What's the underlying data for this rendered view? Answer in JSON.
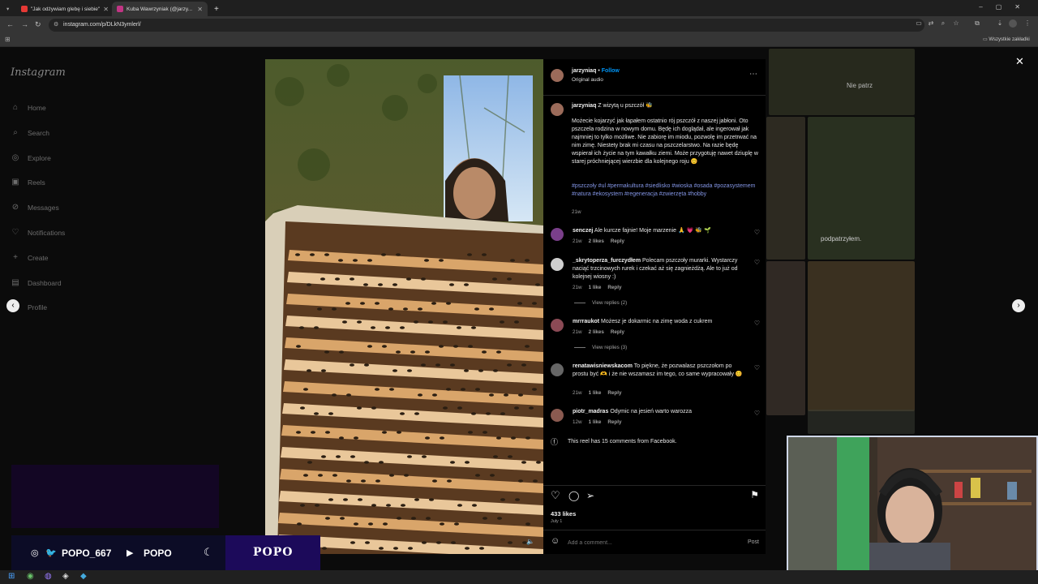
{
  "browser": {
    "tabs": [
      {
        "title": "\"Jak odżywiam glebę i siebie\"",
        "favicon_color": "#e53935"
      },
      {
        "title": "Kuba Wawrzyniak (@jarzy...",
        "favicon_color": "#c13584"
      }
    ],
    "url": "instagram.com/p/DLkN3ymlerl/",
    "bookmarks_label": "Wszystkie zakładki"
  },
  "sidebar": {
    "logo": "Instagram",
    "items": [
      {
        "label": "Home",
        "icon": "home-icon",
        "glyph": "⌂"
      },
      {
        "label": "Search",
        "icon": "search-icon",
        "glyph": "⌕"
      },
      {
        "label": "Explore",
        "icon": "compass-icon",
        "glyph": "◎"
      },
      {
        "label": "Reels",
        "icon": "reels-icon",
        "glyph": "▣"
      },
      {
        "label": "Messages",
        "icon": "messenger-icon",
        "glyph": "⊘"
      },
      {
        "label": "Notifications",
        "icon": "heart-icon",
        "glyph": "♡"
      },
      {
        "label": "Create",
        "icon": "plus-icon",
        "glyph": "+"
      },
      {
        "label": "Dashboard",
        "icon": "dashboard-icon",
        "glyph": "▤"
      },
      {
        "label": "Profile",
        "icon": "profile-icon",
        "glyph": "●"
      }
    ]
  },
  "post": {
    "author": "jarzyniaq",
    "follow_label": "Follow",
    "separator": "•",
    "audio": "Original audio",
    "caption_intro": "Z wizytą u pszczół 🐝",
    "caption": "Możecie kojarzyć jak łapałem ostatnio rój pszczół z naszej jabłoni. Oto pszczela rodzina w nowym domu. Będę ich doglądał, ale ingerował jak najmniej to tylko możliwe. Nie zabiorę im miodu, pozwolę im przetrwać na nim zimę. Niestety brak mi czasu na pszczelarstwo. Na razie będę wspierał ich życie na tym kawałku ziemi. Może przygotuję nawet dziuplę w starej próchniejącej wierzbie dla kolejnego roju 😊",
    "hashtags": "#pszczoły #ul #permakultura #siedlisko #wioska #osada #pozasystemem #natura #ekosystem #regeneracja #zwierzęta #hobby",
    "caption_time": "21w",
    "likes": "433 likes",
    "date": "July 1",
    "comment_placeholder": "Add a comment...",
    "post_button": "Post",
    "facebook_note": "This reel has 15 comments from Facebook.",
    "bg_watermarks": [
      "Nie patrz",
      "podpatrzyłem."
    ]
  },
  "comments": [
    {
      "user": "senczej",
      "text": "Ale kurcze fajnie! Moje marzenie 🙏 💗 🐝 🌱",
      "time": "21w",
      "likes": "2 likes",
      "reply": "Reply",
      "avatar_color": "#7a3f8a"
    },
    {
      "user": "_skrytoperza_furczydłem",
      "text": "Polecam pszczoły murarki. Wystarczy naciąć trzcinowych rurek i czekać aż się zagnieżdżą. Ale to już od kolejnej wiosny :)",
      "time": "21w",
      "likes": "1 like",
      "reply": "Reply",
      "view_replies": "View replies (2)",
      "avatar_color": "#cfcfcf"
    },
    {
      "user": "mrrraukot",
      "text": "Możesz je dokarmic na zimę woda z cukrem",
      "time": "21w",
      "likes": "2 likes",
      "reply": "Reply",
      "view_replies": "View replies (3)",
      "avatar_color": "#8b4a55"
    },
    {
      "user": "renatawisniewskacom",
      "text": "To piękne, że pozwalasz pszczołom po prostu być 🫶 i że nie wszamasz im tego, co same wypracowały 😊",
      "time": "21w",
      "likes": "1 like",
      "reply": "Reply",
      "avatar_color": "#666"
    },
    {
      "user": "piotr_madras",
      "text": "Odymic na jesień warto warozza",
      "time": "12w",
      "likes": "1 like",
      "reply": "Reply",
      "avatar_color": "#8a5a50"
    }
  ],
  "stream_overlay": {
    "twitter_handle": "POPO_667",
    "youtube_handle": "POPO",
    "brand": "POPO"
  },
  "colors": {
    "accent": "#0095f6",
    "hashtag": "#8496e6",
    "bg": "#0b0b0b"
  }
}
